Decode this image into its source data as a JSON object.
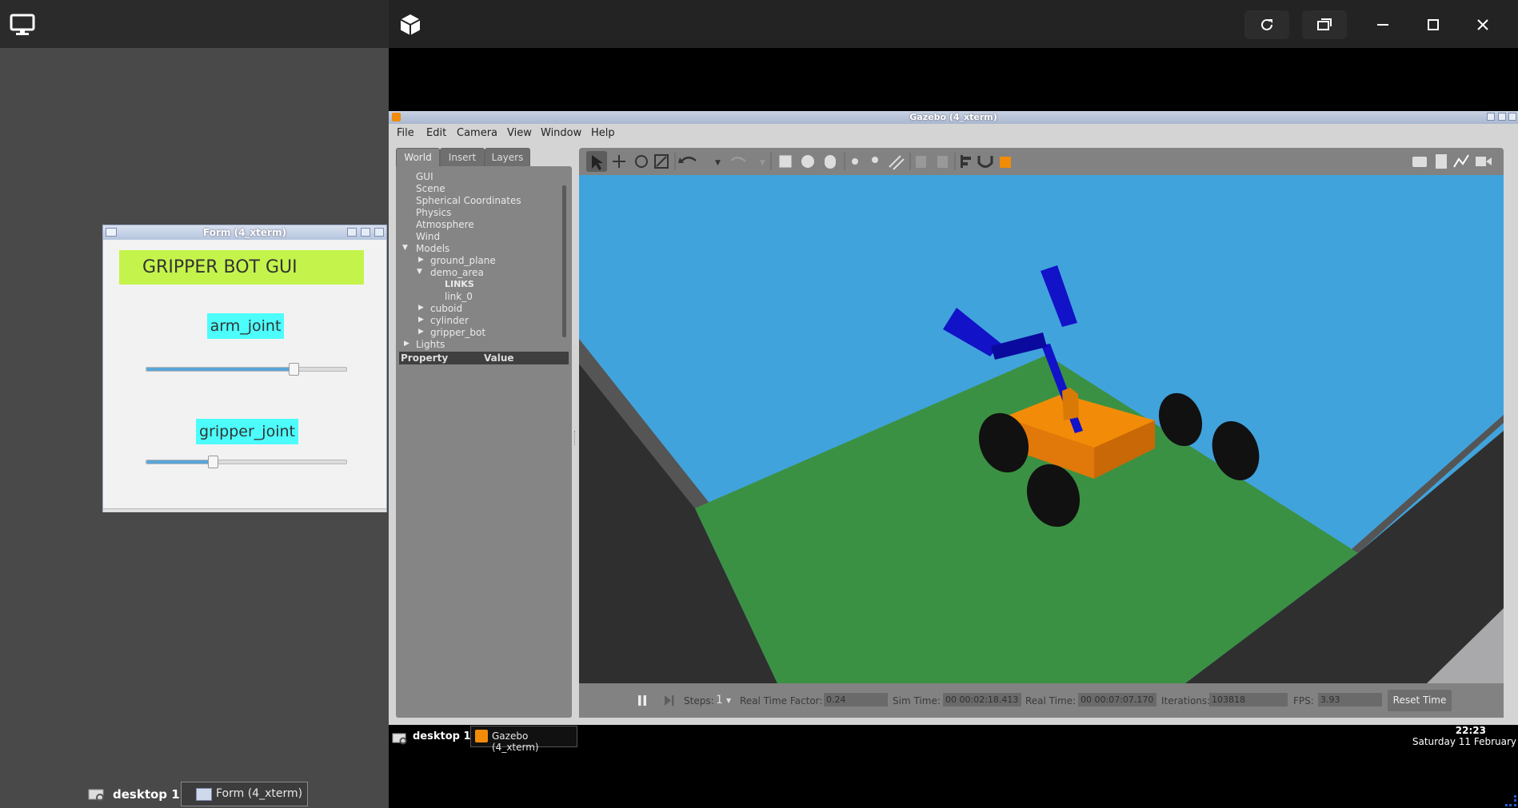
{
  "left_panel": {
    "taskbar": {
      "desktop_label": "desktop 1",
      "window_button": "Form (4_xterm)"
    }
  },
  "form_window": {
    "title": "Form (4_xterm)",
    "heading": "GRIPPER BOT GUI",
    "arm_label": "arm_joint",
    "arm_value": 0.73,
    "gripper_label": "gripper_joint",
    "gripper_value": 0.33
  },
  "gazebo": {
    "title": "Gazebo (4_xterm)",
    "menu": [
      "File",
      "Edit",
      "Camera",
      "View",
      "Window",
      "Help"
    ],
    "tabs": [
      "World",
      "Insert",
      "Layers"
    ],
    "tree": {
      "gui": "GUI",
      "scene": "Scene",
      "spherical": "Spherical Coordinates",
      "physics": "Physics",
      "atmosphere": "Atmosphere",
      "wind": "Wind",
      "models": "Models",
      "ground_plane": "ground_plane",
      "demo_area": "demo_area",
      "links": "LINKS",
      "link_0": "link_0",
      "cuboid": "cuboid",
      "cylinder": "cylinder",
      "gripper_bot": "gripper_bot",
      "lights": "Lights"
    },
    "property_header": {
      "property": "Property",
      "value": "Value"
    },
    "bottom": {
      "steps_label": "Steps:",
      "steps_value": "1",
      "rtf_label": "Real Time Factor:",
      "rtf_value": "0.24",
      "sim_time_label": "Sim Time:",
      "sim_time_value": "00 00:02:18.413",
      "real_time_label": "Real Time:",
      "real_time_value": "00 00:07:07.170",
      "iterations_label": "Iterations:",
      "iterations_value": "103818",
      "fps_label": "FPS:",
      "fps_value": "3.93",
      "reset_button": "Reset Time"
    },
    "taskbar": {
      "desktop_label": "desktop 1",
      "window_button": "Gazebo (4_xterm)",
      "clock_time": "22:23",
      "clock_date": "Saturday 11 February"
    }
  },
  "colors": {
    "sky": "#41a3dc",
    "ground": "#3b9143",
    "robot_body": "#f28b07",
    "arm": "#1212c8",
    "heading_bg": "#c4f44b",
    "label_bg": "#4dfdfc"
  }
}
